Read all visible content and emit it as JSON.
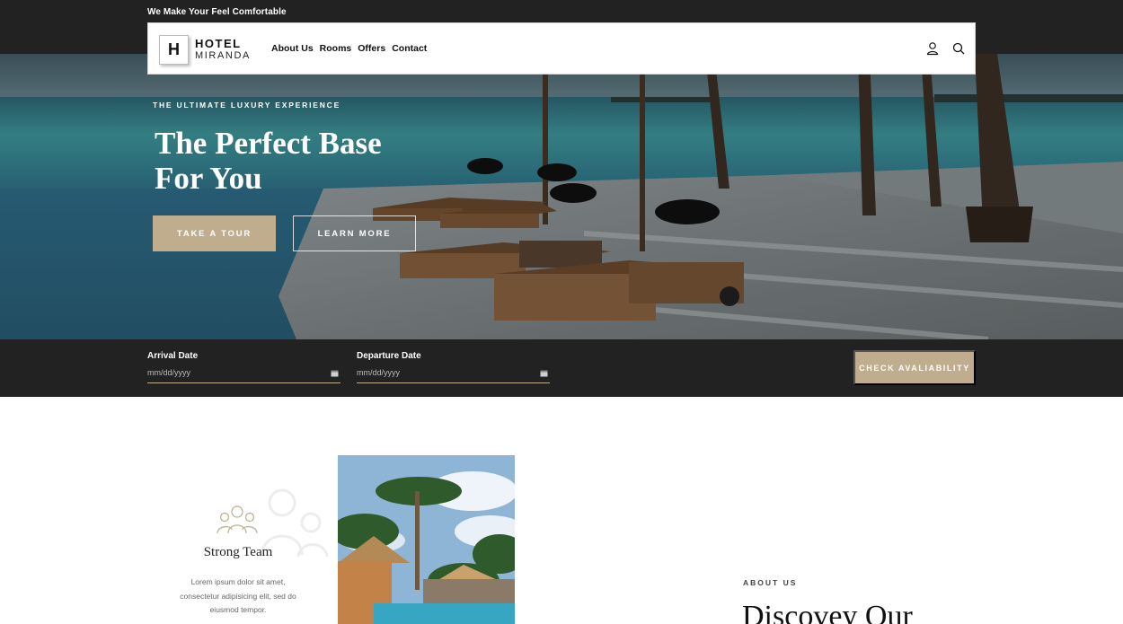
{
  "topbar": {
    "tagline": "We Make Your Feel Comfortable"
  },
  "header": {
    "logo_letter": "H",
    "logo_line1": "HOTEL",
    "logo_line2": "MIRANDA",
    "nav": [
      "About Us",
      "Rooms",
      "Offers",
      "Contact"
    ],
    "icons": [
      "user-icon",
      "search-icon"
    ]
  },
  "hero": {
    "eyebrow": "THE ULTIMATE LUXURY EXPERIENCE",
    "title": "The Perfect Base For You",
    "primary_button": "TAKE A TOUR",
    "secondary_button": "LEARN MORE"
  },
  "booking": {
    "arrival_label": "Arrival Date",
    "arrival_placeholder": "mm/dd/yyyy",
    "departure_label": "Departure Date",
    "departure_placeholder": "mm/dd/yyyy",
    "check_button": "CHECK AVALIABILITY"
  },
  "features": {
    "team_title": "Strong Team",
    "team_text": "Lorem ipsum dolor sit amet, consectetur adipisicing elit, sed do eiusmod tempor."
  },
  "about": {
    "label": "ABOUT US",
    "title": "Discovey Our"
  },
  "colors": {
    "accent": "#bfad8d",
    "dark": "#222222",
    "white": "#ffffff"
  }
}
